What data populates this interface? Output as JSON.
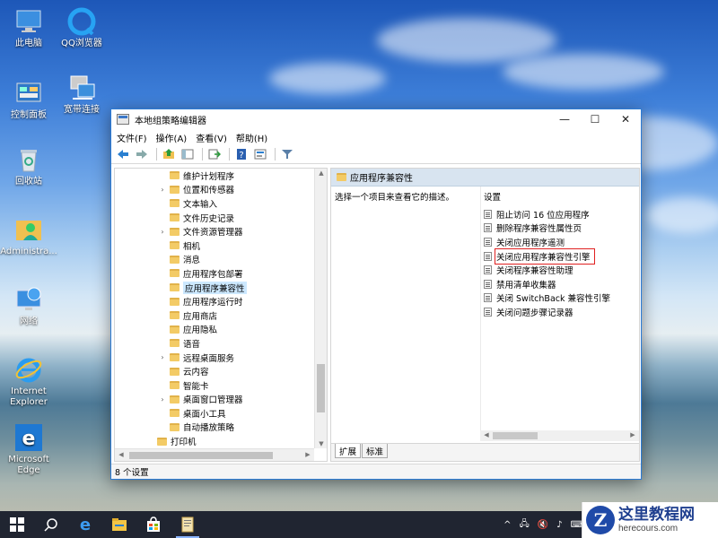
{
  "desktop": {
    "icons": [
      {
        "label": "此电脑",
        "icon": "computer-icon"
      },
      {
        "label": "QQ浏览器",
        "icon": "qq-browser-icon"
      },
      {
        "label": "控制面板",
        "icon": "control-panel-icon"
      },
      {
        "label": "宽带连接",
        "icon": "broadband-icon"
      },
      {
        "label": "回收站",
        "icon": "recycle-bin-icon"
      },
      {
        "label": "Administra...",
        "icon": "user-folder-icon"
      },
      {
        "label": "网络",
        "icon": "network-icon"
      },
      {
        "label": "Internet Explorer",
        "icon": "ie-icon"
      },
      {
        "label": "Microsoft Edge",
        "icon": "edge-icon"
      }
    ]
  },
  "window": {
    "title": "本地组策略编辑器",
    "controls": {
      "minimize": "—",
      "maximize": "☐",
      "close": "✕"
    },
    "menu": [
      "文件(F)",
      "操作(A)",
      "查看(V)",
      "帮助(H)"
    ],
    "toolbar": [
      "back-icon",
      "forward-icon",
      "up-folder-icon",
      "show-tree-icon",
      "export-icon",
      "help-icon",
      "properties-icon",
      "filter-icon"
    ],
    "tree": [
      {
        "label": "维护计划程序",
        "expandable": false,
        "indent": 1
      },
      {
        "label": "位置和传感器",
        "expandable": true,
        "indent": 1
      },
      {
        "label": "文本输入",
        "expandable": false,
        "indent": 1
      },
      {
        "label": "文件历史记录",
        "expandable": false,
        "indent": 1
      },
      {
        "label": "文件资源管理器",
        "expandable": true,
        "indent": 1
      },
      {
        "label": "相机",
        "expandable": false,
        "indent": 1
      },
      {
        "label": "消息",
        "expandable": false,
        "indent": 1
      },
      {
        "label": "应用程序包部署",
        "expandable": false,
        "indent": 1
      },
      {
        "label": "应用程序兼容性",
        "expandable": false,
        "indent": 1,
        "selected": true
      },
      {
        "label": "应用程序运行时",
        "expandable": false,
        "indent": 1
      },
      {
        "label": "应用商店",
        "expandable": false,
        "indent": 1
      },
      {
        "label": "应用隐私",
        "expandable": false,
        "indent": 1
      },
      {
        "label": "语音",
        "expandable": false,
        "indent": 1
      },
      {
        "label": "远程桌面服务",
        "expandable": true,
        "indent": 1
      },
      {
        "label": "云内容",
        "expandable": false,
        "indent": 1
      },
      {
        "label": "智能卡",
        "expandable": false,
        "indent": 1
      },
      {
        "label": "桌面窗口管理器",
        "expandable": true,
        "indent": 1
      },
      {
        "label": "桌面小工具",
        "expandable": false,
        "indent": 1
      },
      {
        "label": "自动播放策略",
        "expandable": false,
        "indent": 1
      },
      {
        "label": "打印机",
        "expandable": false,
        "indent": 0
      }
    ],
    "right": {
      "header": "应用程序兼容性",
      "description": "选择一个项目来查看它的描述。",
      "settings_header": "设置",
      "settings": [
        {
          "label": "阻止访问 16 位应用程序"
        },
        {
          "label": "删除程序兼容性属性页"
        },
        {
          "label": "关闭应用程序遥测"
        },
        {
          "label": "关闭应用程序兼容性引擎",
          "highlighted": true
        },
        {
          "label": "关闭程序兼容性助理"
        },
        {
          "label": "禁用清单收集器"
        },
        {
          "label": "关闭 SwitchBack 兼容性引擎"
        },
        {
          "label": "关闭问题步骤记录器"
        }
      ],
      "tabs": [
        "扩展",
        "标准"
      ]
    },
    "status": "8 个设置"
  },
  "taskbar": {
    "items": [
      "windows-start-icon",
      "search-icon",
      "edge-icon",
      "file-explorer-icon",
      "store-icon",
      "gpedit-icon"
    ],
    "tray": [
      "^",
      "🖧",
      "🔇",
      "♪",
      "⌨"
    ]
  },
  "watermark": {
    "title": "这里教程网",
    "url": "herecours.com",
    "logo": "Z"
  },
  "colors": {
    "accent": "#2b7bd6",
    "selected": "#cce8ff",
    "highlight_box": "#e02020",
    "taskbar": "#121826"
  }
}
